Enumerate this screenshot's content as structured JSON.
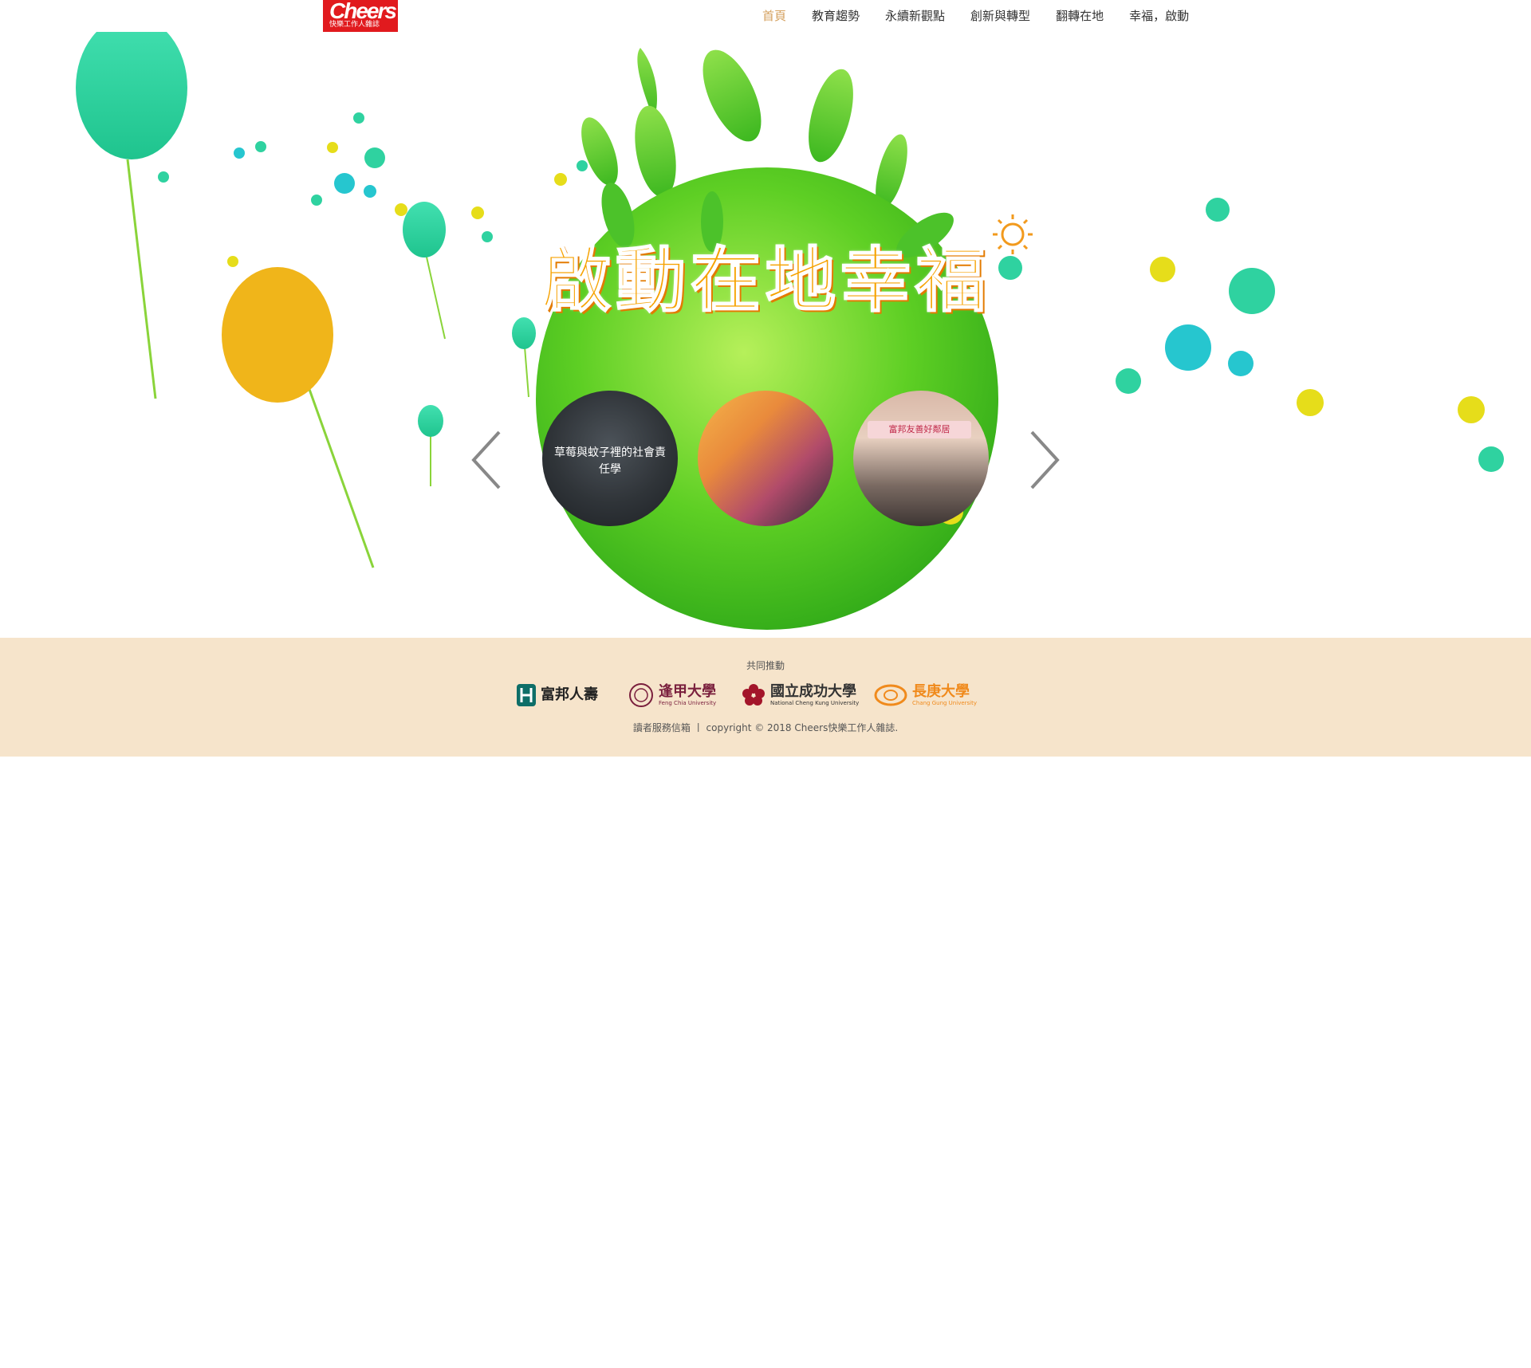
{
  "header": {
    "logo": {
      "title": "Cheers",
      "subtitle": "快樂工作人雜誌"
    },
    "nav": [
      {
        "label": "首頁",
        "active": true
      },
      {
        "label": "教育趨勢",
        "active": false
      },
      {
        "label": "永續新觀點",
        "active": false
      },
      {
        "label": "創新與轉型",
        "active": false
      },
      {
        "label": "翻轉在地",
        "active": false
      },
      {
        "label": "幸福，啟動",
        "active": false
      }
    ]
  },
  "hero": {
    "headline": "啟動在地幸福",
    "slides": [
      {
        "caption": "草莓與蚊子裡的社會責任學"
      },
      {
        "caption": ""
      },
      {
        "caption": "",
        "banner": "富邦友善好鄰居"
      }
    ],
    "prev_icon": "chevron-left-icon",
    "next_icon": "chevron-right-icon"
  },
  "footer": {
    "sponsor_label": "共同推動",
    "partners": [
      {
        "name": "富邦人壽",
        "sub": "",
        "color": "#0e6e68"
      },
      {
        "name": "逢甲大學",
        "sub": "Feng Chia University",
        "color": "#7a1f3d"
      },
      {
        "name": "國立成功大學",
        "sub": "National Cheng Kung University",
        "color": "#333333"
      },
      {
        "name": "長庚大學",
        "sub": "Chang Gung University",
        "color": "#f08a1c"
      }
    ],
    "service_link": "讀者服務信箱",
    "separator": "丨",
    "copyright": "copyright © 2018 Cheers快樂工作人雜誌."
  },
  "colors": {
    "brand_red": "#e11a1e",
    "nav_active": "#d4a05e",
    "headline_orange": "#f6a200",
    "planet_green": "#5ecf24",
    "footer_bg": "#f6e4cb",
    "balloon_teal": "#2fd2a0",
    "balloon_yellow": "#f0b51a"
  }
}
